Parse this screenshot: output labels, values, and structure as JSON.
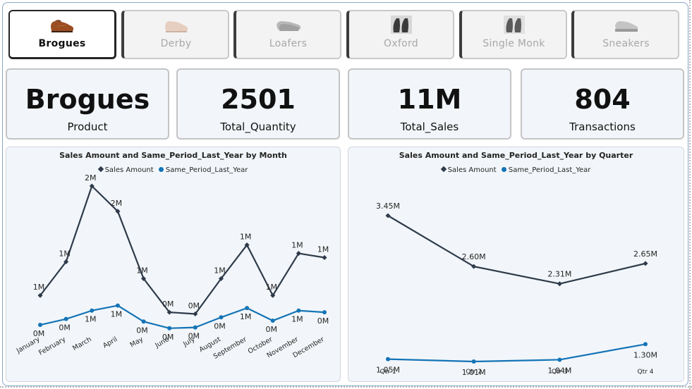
{
  "slicer": {
    "items": [
      {
        "label": "Brogues",
        "selected": true,
        "icon": "brogue-shoe-icon"
      },
      {
        "label": "Derby",
        "selected": false,
        "icon": "derby-shoe-icon"
      },
      {
        "label": "Loafers",
        "selected": false,
        "icon": "loafer-shoe-icon"
      },
      {
        "label": "Oxford",
        "selected": false,
        "icon": "oxford-shoe-icon"
      },
      {
        "label": "Single Monk",
        "selected": false,
        "icon": "monk-shoe-icon"
      },
      {
        "label": "Sneakers",
        "selected": false,
        "icon": "sneaker-shoe-icon"
      }
    ]
  },
  "kpis": [
    {
      "value": "Brogues",
      "label": "Product"
    },
    {
      "value": "2501",
      "label": "Total_Quantity"
    },
    {
      "value": "11M",
      "label": "Total_Sales"
    },
    {
      "value": "804",
      "label": "Transactions"
    }
  ],
  "legend": {
    "series1": "Sales Amount",
    "series2": "Same_Period_Last_Year"
  },
  "colors": {
    "sales": "#2f3b4a",
    "last_year": "#1474b6",
    "card_bg": "#f2f6fa"
  },
  "chart_data": [
    {
      "type": "line",
      "title": "Sales Amount and Same_Period_Last_Year by Month",
      "categories": [
        "January",
        "February",
        "March",
        "April",
        "May",
        "June",
        "July",
        "August",
        "September",
        "October",
        "November",
        "December"
      ],
      "series": [
        {
          "name": "Sales Amount",
          "values": [
            0.8,
            1.2,
            2.1,
            1.8,
            1.0,
            0.6,
            0.58,
            1.0,
            1.4,
            0.8,
            1.3,
            1.25
          ],
          "labels": [
            "1M",
            "1M",
            "2M",
            "2M",
            "1M",
            "0M",
            "0M",
            "1M",
            "1M",
            "1M",
            "1M",
            "1M"
          ]
        },
        {
          "name": "Same_Period_Last_Year",
          "values": [
            0.45,
            0.52,
            0.62,
            0.68,
            0.49,
            0.41,
            0.42,
            0.54,
            0.65,
            0.5,
            0.62,
            0.6
          ],
          "labels": [
            "0M",
            "0M",
            "1M",
            "1M",
            "0M",
            "0M",
            "0M",
            "0M",
            "1M",
            "0M",
            "1M",
            "0M"
          ]
        }
      ],
      "grid": false,
      "legend": "top-center"
    },
    {
      "type": "line",
      "title": "Sales Amount and Same_Period_Last_Year by Quarter",
      "categories": [
        "Qtr 1",
        "Qtr 2",
        "Qtr 3",
        "Qtr 4"
      ],
      "series": [
        {
          "name": "Sales Amount",
          "values": [
            3.45,
            2.6,
            2.31,
            2.65
          ],
          "labels": [
            "3.45M",
            "2.60M",
            "2.31M",
            "2.65M"
          ]
        },
        {
          "name": "Same_Period_Last_Year",
          "values": [
            1.05,
            1.01,
            1.04,
            1.3
          ],
          "labels": [
            "1.05M",
            "1.01M",
            "1.04M",
            "1.30M"
          ]
        }
      ],
      "grid": false,
      "legend": "top-center"
    }
  ]
}
